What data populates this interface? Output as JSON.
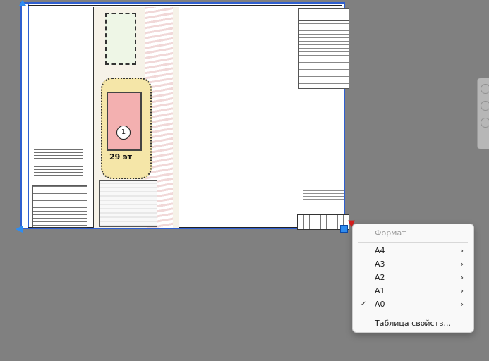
{
  "context_menu": {
    "title": "Формат",
    "items": [
      {
        "label": "А4",
        "arrow": "›"
      },
      {
        "label": "А3",
        "arrow": "›"
      },
      {
        "label": "А2",
        "arrow": "›"
      },
      {
        "label": "А1",
        "arrow": "›"
      },
      {
        "label": "А0",
        "arrow": "›",
        "check": "✓"
      }
    ],
    "properties_label": "Таблица свойств..."
  },
  "drawing": {
    "building_number": "1",
    "area_label": "29 эт"
  },
  "icons": {
    "grip_menu": "triangle-down-icon",
    "cursor": "arrow-cursor-icon"
  },
  "colors": {
    "background": "#808080",
    "selection": "#2f5fd0",
    "grip": "#2f8cf0",
    "grip_menu": "#d51f1f"
  }
}
